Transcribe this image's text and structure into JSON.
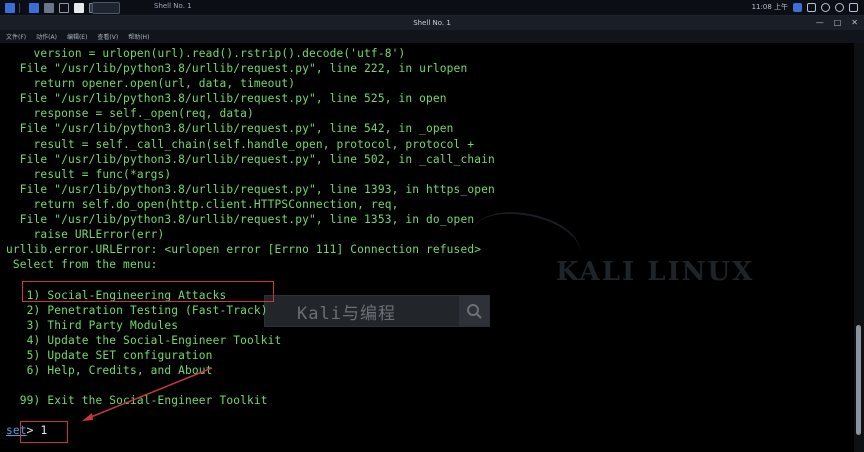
{
  "taskbar": {
    "active_task": "Shell No. 1",
    "clock": "11:08 上午",
    "icons": [
      "kali-menu-icon",
      "workspace-1-icon",
      "workspace-2-icon",
      "workspace-3-icon",
      "workspace-4-icon",
      "file-manager-icon",
      "terminal-task-icon"
    ],
    "colors": {
      "blue": "#3b6fd6",
      "gray": "#6c7686",
      "white": "#e6e9ee",
      "green": "#3bbd5e"
    }
  },
  "window": {
    "title": "Shell No. 1",
    "minimize": "—",
    "maximize": "□",
    "close": "✕"
  },
  "menu": [
    "文件(F)",
    "动作(A)",
    "编辑(E)",
    "查看(V)",
    "帮助(H)"
  ],
  "terminal": {
    "lines": [
      "    version = urlopen(url).read().rstrip().decode('utf-8')",
      "  File \"/usr/lib/python3.8/urllib/request.py\", line 222, in urlopen",
      "    return opener.open(url, data, timeout)",
      "  File \"/usr/lib/python3.8/urllib/request.py\", line 525, in open",
      "    response = self._open(req, data)",
      "  File \"/usr/lib/python3.8/urllib/request.py\", line 542, in _open",
      "    result = self._call_chain(self.handle_open, protocol, protocol +",
      "  File \"/usr/lib/python3.8/urllib/request.py\", line 502, in _call_chain",
      "    result = func(*args)",
      "  File \"/usr/lib/python3.8/urllib/request.py\", line 1393, in https_open",
      "    return self.do_open(http.client.HTTPSConnection, req,",
      "  File \"/usr/lib/python3.8/urllib/request.py\", line 1353, in do_open",
      "    raise URLError(err)",
      "urllib.error.URLError: <urlopen error [Errno 111] Connection refused>",
      " Select from the menu:",
      "",
      "   1) Social-Engineering Attacks",
      "   2) Penetration Testing (Fast-Track)",
      "   3) Third Party Modules",
      "   4) Update the Social-Engineer Toolkit",
      "   5) Update SET configuration",
      "   6) Help, Credits, and About",
      "",
      "  99) Exit the Social-Engineer Toolkit",
      ""
    ],
    "prompt_label": "set",
    "prompt_suffix": "> ",
    "prompt_input": "1",
    "text_color": "#72d96a",
    "watermark": "KALI LINUX",
    "overlay_caption": "Kali与编程",
    "annotation_color": "#c8383a"
  }
}
